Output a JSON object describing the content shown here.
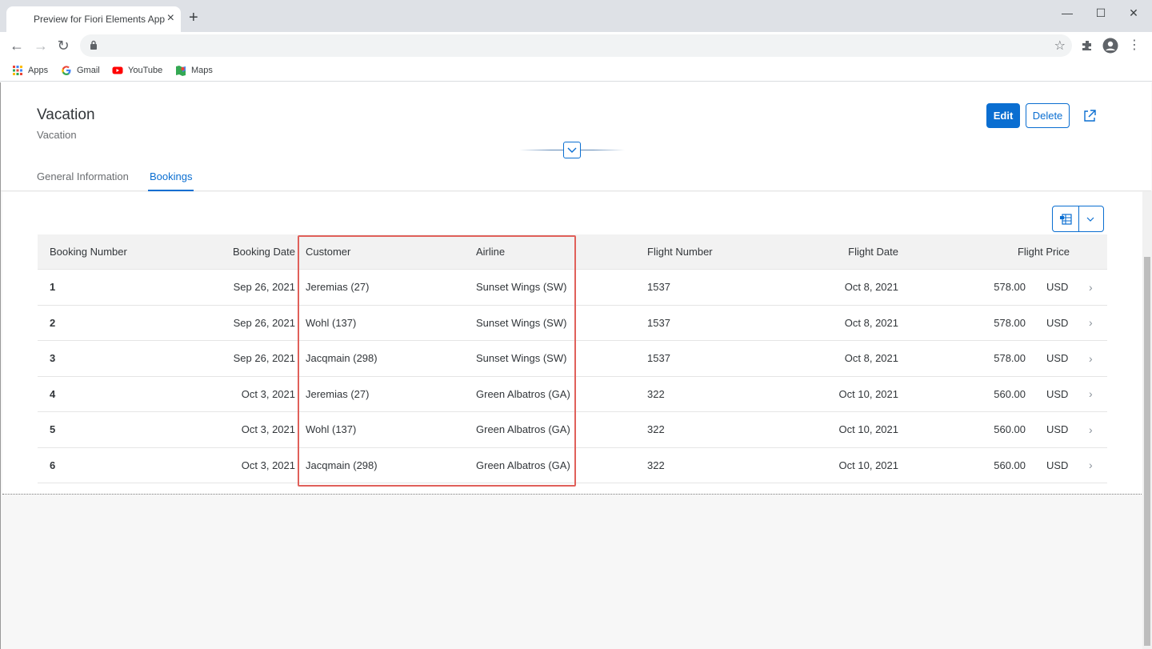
{
  "browser": {
    "tab_title": "Preview for Fiori Elements App",
    "tab_close": "×",
    "new_tab": "+",
    "window_controls": {
      "minimize": "—",
      "maximize": "☐",
      "close": "✕"
    },
    "nav": {
      "back": "←",
      "forward": "→",
      "reload": "↻"
    },
    "star_icon": "☆",
    "menu_icon": "⋮",
    "bookmarks": [
      {
        "label": "Apps",
        "icon": "apps-grid-icon"
      },
      {
        "label": "Gmail",
        "icon": "google-icon"
      },
      {
        "label": "YouTube",
        "icon": "youtube-icon"
      },
      {
        "label": "Maps",
        "icon": "maps-icon"
      }
    ]
  },
  "header": {
    "title": "Vacation",
    "subtitle": "Vacation",
    "edit_label": "Edit",
    "delete_label": "Delete",
    "tabs": [
      {
        "label": "General Information",
        "active": false
      },
      {
        "label": "Bookings",
        "active": true
      }
    ]
  },
  "table": {
    "columns": [
      "Booking Number",
      "Booking Date",
      "Customer",
      "Airline",
      "Flight Number",
      "Flight Date",
      "Flight Price"
    ],
    "rows": [
      {
        "booking_number": "1",
        "booking_date": "Sep 26, 2021",
        "customer": "Jeremias (27)",
        "airline": "Sunset Wings (SW)",
        "flight_number": "1537",
        "flight_date": "Oct 8, 2021",
        "price": "578.00",
        "currency": "USD"
      },
      {
        "booking_number": "2",
        "booking_date": "Sep 26, 2021",
        "customer": "Wohl (137)",
        "airline": "Sunset Wings (SW)",
        "flight_number": "1537",
        "flight_date": "Oct 8, 2021",
        "price": "578.00",
        "currency": "USD"
      },
      {
        "booking_number": "3",
        "booking_date": "Sep 26, 2021",
        "customer": "Jacqmain (298)",
        "airline": "Sunset Wings (SW)",
        "flight_number": "1537",
        "flight_date": "Oct 8, 2021",
        "price": "578.00",
        "currency": "USD"
      },
      {
        "booking_number": "4",
        "booking_date": "Oct 3, 2021",
        "customer": "Jeremias (27)",
        "airline": "Green Albatros (GA)",
        "flight_number": "322",
        "flight_date": "Oct 10, 2021",
        "price": "560.00",
        "currency": "USD"
      },
      {
        "booking_number": "5",
        "booking_date": "Oct 3, 2021",
        "customer": "Wohl (137)",
        "airline": "Green Albatros (GA)",
        "flight_number": "322",
        "flight_date": "Oct 10, 2021",
        "price": "560.00",
        "currency": "USD"
      },
      {
        "booking_number": "6",
        "booking_date": "Oct 3, 2021",
        "customer": "Jacqmain (298)",
        "airline": "Green Albatros (GA)",
        "flight_number": "322",
        "flight_date": "Oct 10, 2021",
        "price": "560.00",
        "currency": "USD"
      }
    ],
    "nav_arrow": "›"
  },
  "colors": {
    "accent": "#0a6ed1",
    "highlight": "#e0605a",
    "table_header_bg": "#f2f2f2"
  }
}
